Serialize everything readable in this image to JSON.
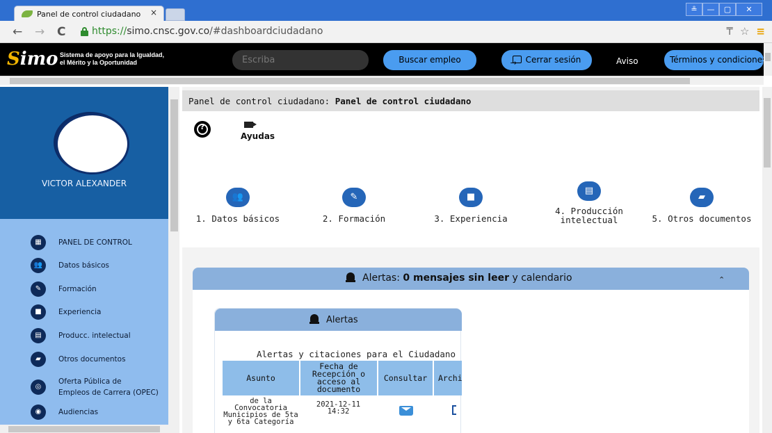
{
  "browser": {
    "tab_title": "Panel de control ciudadano",
    "tab_close": "×",
    "url_scheme": "https://",
    "url_host": "simo.cnsc.gov.co",
    "url_path": "/#dashboardciudadano",
    "back": "←",
    "forward": "→",
    "reload": "C",
    "bookmark_star": "☆",
    "menu": "≡",
    "ext": "₸",
    "win_min": "—",
    "win_max": "▢",
    "win_close": "✕",
    "win_user": "≗"
  },
  "header": {
    "logo_text_line1": "Sistema de apoyo para la Igualdad,",
    "logo_text_line2": "el Mérito y la Oportunidad",
    "logo_mark_s": "S",
    "logo_mark_rest": "imo",
    "search_placeholder": "Escriba",
    "buscar_label": "Buscar empleo",
    "cerrar_label": "Cerrar sesión",
    "aviso_label": "Aviso",
    "terminos_label": "Términos y condiciones"
  },
  "sidebar": {
    "username": "VICTOR ALEXANDER",
    "items": [
      {
        "label": "PANEL DE CONTROL",
        "icon": "dashboard-icon",
        "glyph": "▦"
      },
      {
        "label": "Datos básicos",
        "icon": "people-icon",
        "glyph": "👥"
      },
      {
        "label": "Formación",
        "icon": "education-icon",
        "glyph": "✎"
      },
      {
        "label": "Experiencia",
        "icon": "briefcase-icon",
        "glyph": "■"
      },
      {
        "label": "Producc. intelectual",
        "icon": "publication-icon",
        "glyph": "▤"
      },
      {
        "label": "Otros documentos",
        "icon": "document-icon",
        "glyph": "▰"
      },
      {
        "label": "Oferta Pública de",
        "label2": "Empleos de Carrera (OPEC)",
        "icon": "opec-icon",
        "glyph": "◎"
      },
      {
        "label": "Audiencias",
        "icon": "audience-icon",
        "glyph": "◉"
      }
    ]
  },
  "main": {
    "breadcrumb_prefix": "Panel de control ciudadano:",
    "breadcrumb_current": "Panel de control ciudadano",
    "help_glyph": "?",
    "ayudas_label": "Ayudas",
    "steps": [
      {
        "label": "1. Datos básicos",
        "icon": "people-icon",
        "glyph": "👥"
      },
      {
        "label": "2. Formación",
        "icon": "education-icon",
        "glyph": "✎"
      },
      {
        "label": "3. Experiencia",
        "icon": "briefcase-icon",
        "glyph": "■"
      },
      {
        "label": "4. Producción",
        "label2": "intelectual",
        "icon": "publication-icon",
        "glyph": "▤"
      },
      {
        "label": "5. Otros documentos",
        "icon": "document-icon",
        "glyph": "▰"
      }
    ],
    "alerts": {
      "head_prefix": "Alertas:",
      "head_bold": "0 mensajes sin leer",
      "head_suffix": "y calendario",
      "chevron": "⌃",
      "card_title": "Alertas",
      "caption": "Alertas y citaciones para el Ciudadano",
      "columns": [
        "Asunto",
        "Fecha de Recepción o acceso al documento",
        "Consultar",
        "Archi"
      ],
      "row": {
        "asunto": "de la Convocatoria Municipios de 5ta y 6ta Categoría",
        "fecha": "2021-12-11 14:32"
      }
    }
  }
}
